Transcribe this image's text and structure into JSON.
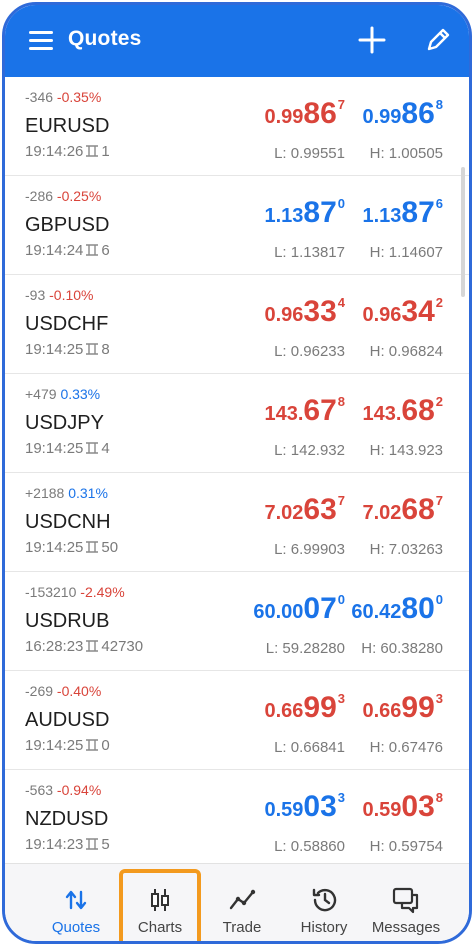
{
  "header": {
    "title": "Quotes",
    "add_icon": "plus-icon",
    "edit_icon": "pencil-icon"
  },
  "quotes": [
    {
      "change": "-346",
      "pct": "-0.35%",
      "symbol": "EURUSD",
      "time": "19:14:26",
      "spread": "1",
      "bid_pre": "0.99",
      "bid_big": "86",
      "bid_sup": "7",
      "bid_color": "red",
      "ask_pre": "0.99",
      "ask_big": "86",
      "ask_sup": "8",
      "ask_color": "blue",
      "low": "L: 0.99551",
      "high": "H: 1.00505"
    },
    {
      "change": "-286",
      "pct": "-0.25%",
      "symbol": "GBPUSD",
      "time": "19:14:24",
      "spread": "6",
      "bid_pre": "1.13",
      "bid_big": "87",
      "bid_sup": "0",
      "bid_color": "blue",
      "ask_pre": "1.13",
      "ask_big": "87",
      "ask_sup": "6",
      "ask_color": "blue",
      "low": "L: 1.13817",
      "high": "H: 1.14607"
    },
    {
      "change": "-93",
      "pct": "-0.10%",
      "symbol": "USDCHF",
      "time": "19:14:25",
      "spread": "8",
      "bid_pre": "0.96",
      "bid_big": "33",
      "bid_sup": "4",
      "bid_color": "red",
      "ask_pre": "0.96",
      "ask_big": "34",
      "ask_sup": "2",
      "ask_color": "red",
      "low": "L: 0.96233",
      "high": "H: 0.96824"
    },
    {
      "change": "+479",
      "pct": "0.33%",
      "symbol": "USDJPY",
      "time": "19:14:25",
      "spread": "4",
      "bid_pre": "143.",
      "bid_big": "67",
      "bid_sup": "8",
      "bid_color": "red",
      "ask_pre": "143.",
      "ask_big": "68",
      "ask_sup": "2",
      "ask_color": "red",
      "low": "L: 142.932",
      "high": "H: 143.923"
    },
    {
      "change": "+2188",
      "pct": "0.31%",
      "symbol": "USDCNH",
      "time": "19:14:25",
      "spread": "50",
      "bid_pre": "7.02",
      "bid_big": "63",
      "bid_sup": "7",
      "bid_color": "red",
      "ask_pre": "7.02",
      "ask_big": "68",
      "ask_sup": "7",
      "ask_color": "red",
      "low": "L: 6.99903",
      "high": "H: 7.03263"
    },
    {
      "change": "-153210",
      "pct": "-2.49%",
      "symbol": "USDRUB",
      "time": "16:28:23",
      "spread": "42730",
      "bid_pre": "60.00",
      "bid_big": "07",
      "bid_sup": "0",
      "bid_color": "blue",
      "ask_pre": "60.42",
      "ask_big": "80",
      "ask_sup": "0",
      "ask_color": "blue",
      "low": "L: 59.28280",
      "high": "H: 60.38280"
    },
    {
      "change": "-269",
      "pct": "-0.40%",
      "symbol": "AUDUSD",
      "time": "19:14:25",
      "spread": "0",
      "bid_pre": "0.66",
      "bid_big": "99",
      "bid_sup": "3",
      "bid_color": "red",
      "ask_pre": "0.66",
      "ask_big": "99",
      "ask_sup": "3",
      "ask_color": "red",
      "low": "L: 0.66841",
      "high": "H: 0.67476"
    },
    {
      "change": "-563",
      "pct": "-0.94%",
      "symbol": "NZDUSD",
      "time": "19:14:23",
      "spread": "5",
      "bid_pre": "0.59",
      "bid_big": "03",
      "bid_sup": "3",
      "bid_color": "blue",
      "ask_pre": "0.59",
      "ask_big": "03",
      "ask_sup": "8",
      "ask_color": "red",
      "low": "L: 0.58860",
      "high": "H: 0.59754"
    }
  ],
  "nav": [
    {
      "label": "Quotes",
      "icon": "quotes-arrows-icon",
      "active": true
    },
    {
      "label": "Charts",
      "icon": "candlestick-chart-icon",
      "active": false
    },
    {
      "label": "Trade",
      "icon": "trade-line-icon",
      "active": false
    },
    {
      "label": "History",
      "icon": "history-clock-icon",
      "active": false
    },
    {
      "label": "Messages",
      "icon": "messages-chat-icon",
      "active": false
    }
  ],
  "colors": {
    "accent": "#1a73e8",
    "negative": "#d9443a",
    "highlight": "#f39a1e",
    "muted": "#7a7a7a"
  }
}
